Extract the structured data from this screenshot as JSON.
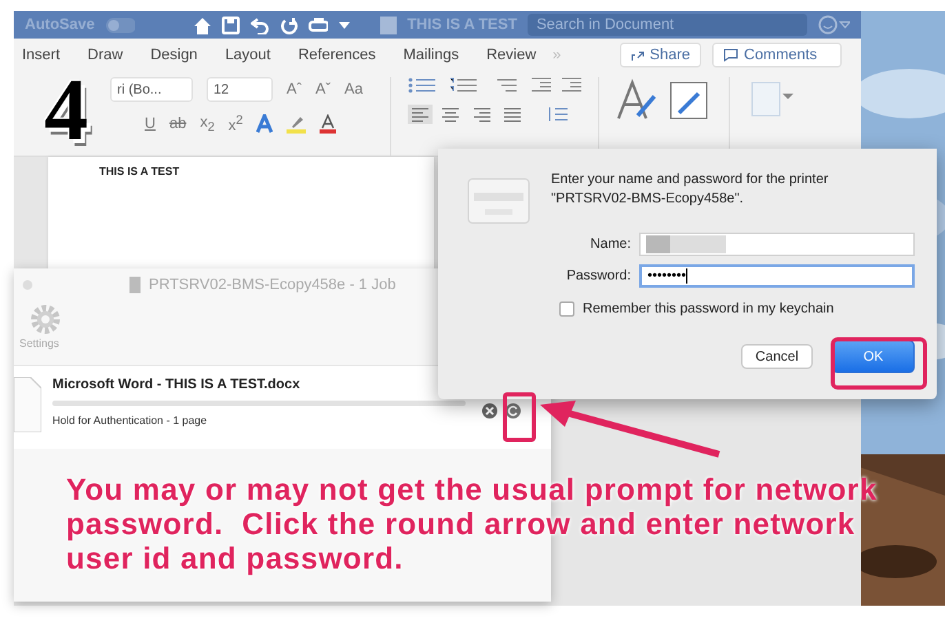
{
  "word": {
    "autosave": "AutoSave",
    "doc_title": "THIS IS A TEST",
    "search": {
      "placeholder": "Search in Document"
    },
    "tabs": [
      {
        "label": "Insert"
      },
      {
        "label": "Draw"
      },
      {
        "label": "Design"
      },
      {
        "label": "Layout"
      },
      {
        "label": "References"
      },
      {
        "label": "Mailings"
      },
      {
        "label": "Review"
      }
    ],
    "more": "»",
    "share": "Share",
    "comments": "Comments",
    "font_name": "ri (Bo...",
    "font_size": "12",
    "format_row_1": [
      "Aˆ",
      "Aˇ",
      "Aa"
    ],
    "format_row_2": [
      "U",
      "ab",
      "x$_{2}$",
      "x$^{2}$"
    ],
    "page_text": "THIS IS A TEST"
  },
  "print_queue": {
    "title": "PRTSRV02-BMS-Ecopy458e - 1 Job",
    "settings": "Settings",
    "job": {
      "name": "Microsoft Word - THIS IS A TEST.docx",
      "status": "Hold for Authentication - 1 page"
    }
  },
  "dialog": {
    "message": "Enter your name and password for the printer \"PRTSRV02-BMS-Ecopy458e\".",
    "fields": [
      {
        "label": "Name:",
        "redacted": true,
        "focused": false
      },
      {
        "label": "Password:",
        "value": "••••••••",
        "redacted": false,
        "focused": true
      }
    ],
    "remember": {
      "label": "Remember this password in my keychain",
      "checked": false
    },
    "buttons": [
      {
        "label": "Cancel",
        "default": false
      },
      {
        "label": "OK",
        "default": true
      }
    ]
  },
  "annotation": {
    "step": "4",
    "note": "You may or may not get the usual prompt for network password.  Click the round arrow and enter network user id and password."
  }
}
